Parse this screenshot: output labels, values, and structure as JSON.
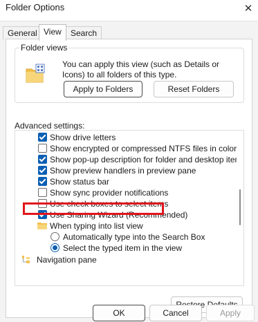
{
  "window": {
    "title": "Folder Options",
    "close_glyph": "✕"
  },
  "tabs": [
    {
      "label": "General",
      "active": false
    },
    {
      "label": "View",
      "active": true
    },
    {
      "label": "Search",
      "active": false
    }
  ],
  "folder_views": {
    "legend": "Folder views",
    "description": "You can apply this view (such as Details or Icons) to all folders of this type.",
    "icon": "folder-view-icon",
    "apply_button": "Apply to Folders",
    "reset_button": "Reset Folders"
  },
  "advanced": {
    "label": "Advanced settings:",
    "items": [
      {
        "type": "checkbox",
        "label": "Show drive letters",
        "checked": true
      },
      {
        "type": "checkbox",
        "label": "Show encrypted or compressed NTFS files in color",
        "checked": false
      },
      {
        "type": "checkbox",
        "label": "Show pop-up description for folder and desktop items",
        "checked": true
      },
      {
        "type": "checkbox",
        "label": "Show preview handlers in preview pane",
        "checked": true
      },
      {
        "type": "checkbox",
        "label": "Show status bar",
        "checked": true
      },
      {
        "type": "checkbox",
        "label": "Show sync provider notifications",
        "checked": false,
        "highlighted": true
      },
      {
        "type": "checkbox",
        "label": "Use check boxes to select items",
        "checked": false
      },
      {
        "type": "checkbox",
        "label": "Use Sharing Wizard (Recommended)",
        "checked": true
      },
      {
        "type": "folder",
        "label": "When typing into list view",
        "icon": "folder-icon"
      },
      {
        "type": "radio",
        "label": "Automatically type into the Search Box",
        "checked": false
      },
      {
        "type": "radio",
        "label": "Select the typed item in the view",
        "checked": true
      },
      {
        "type": "node",
        "label": "Navigation pane",
        "icon": "navigation-pane-icon"
      }
    ]
  },
  "restore_button": "Restore Defaults",
  "footer": {
    "ok": "OK",
    "cancel": "Cancel",
    "apply": "Apply"
  },
  "colors": {
    "accent": "#0a5fb4",
    "highlight_box": "#e0151b"
  }
}
